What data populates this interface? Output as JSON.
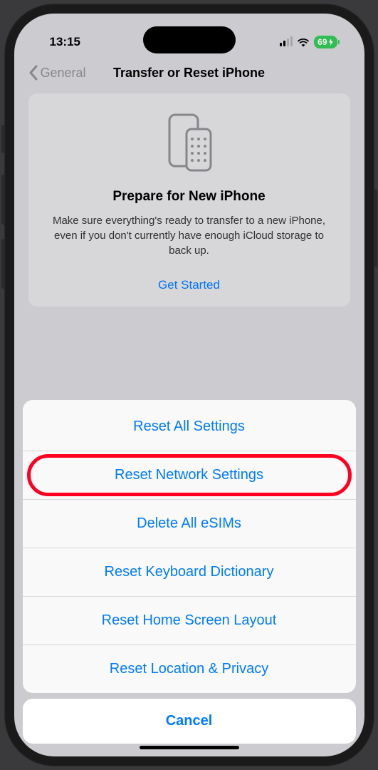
{
  "status": {
    "time": "13:15",
    "battery": "69"
  },
  "nav": {
    "back": "General",
    "title": "Transfer or Reset iPhone"
  },
  "card": {
    "title": "Prepare for New iPhone",
    "description": "Make sure everything's ready to transfer to a new iPhone, even if you don't currently have enough iCloud storage to back up.",
    "action": "Get Started"
  },
  "sheet": {
    "items": [
      {
        "label": "Reset All Settings",
        "highlighted": false
      },
      {
        "label": "Reset Network Settings",
        "highlighted": true
      },
      {
        "label": "Delete All eSIMs",
        "highlighted": false
      },
      {
        "label": "Reset Keyboard Dictionary",
        "highlighted": false
      },
      {
        "label": "Reset Home Screen Layout",
        "highlighted": false
      },
      {
        "label": "Reset Location & Privacy",
        "highlighted": false
      }
    ],
    "cancel": "Cancel"
  }
}
